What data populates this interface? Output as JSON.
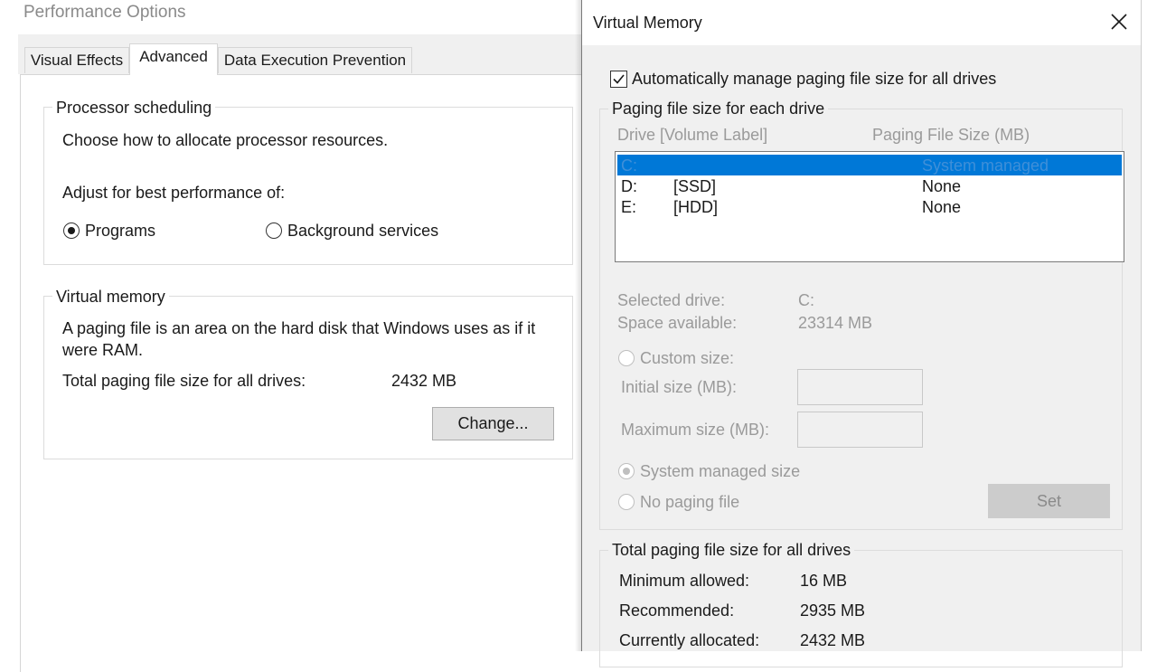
{
  "perf": {
    "title": "Performance Options",
    "tabs": [
      {
        "label": "Visual Effects"
      },
      {
        "label": "Advanced"
      },
      {
        "label": "Data Execution Prevention"
      }
    ],
    "processor": {
      "legend": "Processor scheduling",
      "description": "Choose how to allocate processor resources.",
      "adjust_label": "Adjust for best performance of:",
      "option_programs": "Programs",
      "option_background": "Background services",
      "selected": "Programs"
    },
    "virtual_memory": {
      "legend": "Virtual memory",
      "description_line1": "A paging file is an area on the hard disk that Windows uses as if it",
      "description_line2": "were RAM.",
      "total_label": "Total paging file size for all drives:",
      "total_value": "2432 MB",
      "change_button": "Change..."
    }
  },
  "vm": {
    "title": "Virtual Memory",
    "auto_manage_label": "Automatically manage paging file size for all drives",
    "auto_manage_checked": true,
    "drive_group": {
      "legend": "Paging file size for each drive",
      "col_drive": "Drive  [Volume Label]",
      "col_size": "Paging File Size (MB)",
      "rows": [
        {
          "drive": "C:",
          "label": "",
          "size": "System managed",
          "selected": true
        },
        {
          "drive": "D:",
          "label": "[SSD]",
          "size": "None",
          "selected": false
        },
        {
          "drive": "E:",
          "label": "[HDD]",
          "size": "None",
          "selected": false
        }
      ],
      "selected_drive_label": "Selected drive:",
      "selected_drive_value": "C:",
      "space_available_label": "Space available:",
      "space_available_value": "23314 MB",
      "custom_size_label": "Custom size:",
      "initial_size_label": "Initial size (MB):",
      "initial_size_value": "",
      "maximum_size_label": "Maximum size (MB):",
      "maximum_size_value": "",
      "system_managed_label": "System managed size",
      "no_paging_label": "No paging file",
      "set_button": "Set"
    },
    "totals": {
      "legend": "Total paging file size for all drives",
      "minimum_label": "Minimum allowed:",
      "minimum_value": "16 MB",
      "recommended_label": "Recommended:",
      "recommended_value": "2935 MB",
      "current_label": "Currently allocated:",
      "current_value": "2432 MB"
    },
    "colors": {
      "selection": "#0078d7",
      "dialog_bg": "#f0f0f0"
    }
  }
}
